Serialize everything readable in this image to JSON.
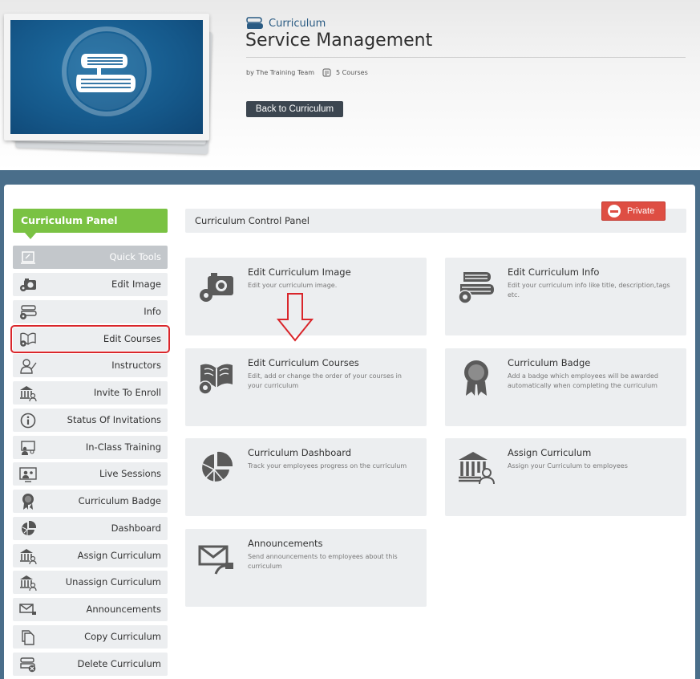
{
  "header": {
    "category": "Curriculum",
    "title": "Service Management",
    "author": "by The Training Team",
    "course_count": "5 Courses",
    "back_button": "Back to Curriculum"
  },
  "sidebar": {
    "title": "Curriculum Panel",
    "items": [
      {
        "label": "Quick Tools",
        "icon": "quick-tools-icon"
      },
      {
        "label": "Edit Image",
        "icon": "camera-gear-icon"
      },
      {
        "label": "Info",
        "icon": "books-gear-icon"
      },
      {
        "label": "Edit Courses",
        "icon": "book-gear-icon",
        "highlighted": true
      },
      {
        "label": "Instructors",
        "icon": "instructor-icon"
      },
      {
        "label": "Invite To Enroll",
        "icon": "institution-user-icon"
      },
      {
        "label": "Status Of Invitations",
        "icon": "info-circle-icon"
      },
      {
        "label": "In-Class Training",
        "icon": "classroom-icon"
      },
      {
        "label": "Live Sessions",
        "icon": "live-session-icon"
      },
      {
        "label": "Curriculum Badge",
        "icon": "badge-icon"
      },
      {
        "label": "Dashboard",
        "icon": "pie-chart-icon"
      },
      {
        "label": "Assign Curriculum",
        "icon": "institution-user-icon"
      },
      {
        "label": "Unassign Curriculum",
        "icon": "institution-user-icon"
      },
      {
        "label": "Announcements",
        "icon": "envelope-arrow-icon"
      },
      {
        "label": "Copy Curriculum",
        "icon": "copy-icon"
      },
      {
        "label": "Delete Curriculum",
        "icon": "books-delete-icon"
      }
    ]
  },
  "control_panel": {
    "title": "Curriculum Control Panel",
    "private_label": "Private",
    "cards": [
      {
        "title": "Edit Curriculum Image",
        "desc": "Edit your curriculum image.",
        "icon": "camera-gear-icon"
      },
      {
        "title": "Edit Curriculum Info",
        "desc": "Edit your curriculum info like title, description,tags etc.",
        "icon": "books-gear-icon"
      },
      {
        "title": "Edit Curriculum Courses",
        "desc": "Edit, add or change the order of your courses in your curriculum",
        "icon": "book-gear-icon"
      },
      {
        "title": "Curriculum Badge",
        "desc": "Add a badge which employees will be awarded automatically when completing the curriculum",
        "icon": "badge-icon"
      },
      {
        "title": "Curriculum Dashboard",
        "desc": "Track your employees progress on the curriculum",
        "icon": "pie-chart-icon"
      },
      {
        "title": "Assign Curriculum",
        "desc": "Assign your Curriculum to employees",
        "icon": "institution-user-icon"
      },
      {
        "title": "Announcements",
        "desc": "Send announcements to employees about this curriculum",
        "icon": "envelope-arrow-icon"
      }
    ]
  },
  "colors": {
    "accent_green": "#7ac243",
    "band_blue": "#4a6e8a",
    "private_red": "#de4e43",
    "highlight_red": "#d9262b",
    "annotation_arrow": "#d9262b"
  }
}
